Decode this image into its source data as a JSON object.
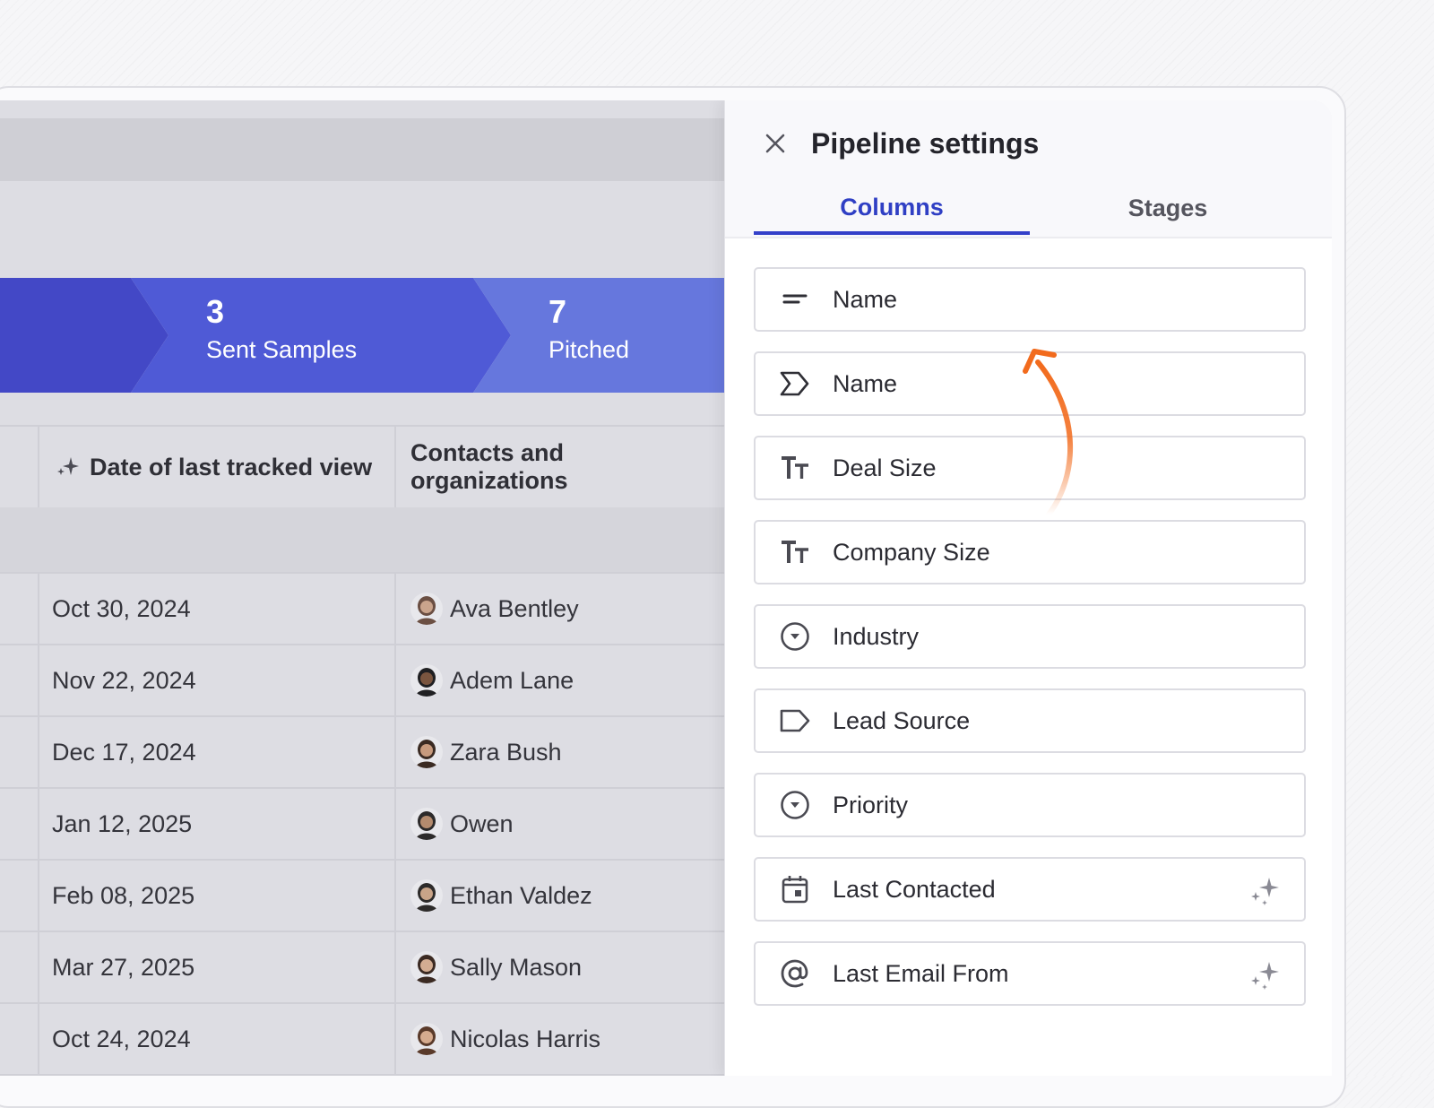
{
  "pipeline": {
    "stages": [
      {
        "count": "3",
        "label": "Sent Samples"
      },
      {
        "count": "7",
        "label": "Pitched"
      }
    ],
    "colors": {
      "stage1": "#4348c6",
      "stage2": "#4f5ad6",
      "stage3": "#6677dd"
    }
  },
  "table": {
    "headers": {
      "date": "Date of last tracked view",
      "contacts": "Contacts and organizations"
    },
    "rows": [
      {
        "date": "Oct 30, 2024",
        "contact": "Ava Bentley"
      },
      {
        "date": "Nov 22, 2024",
        "contact": "Adem Lane"
      },
      {
        "date": "Dec 17, 2024",
        "contact": "Zara Bush"
      },
      {
        "date": "Jan 12, 2025",
        "contact": "Owen"
      },
      {
        "date": "Feb 08, 2025",
        "contact": "Ethan Valdez"
      },
      {
        "date": "Mar 27, 2025",
        "contact": "Sally Mason"
      },
      {
        "date": "Oct 24, 2024",
        "contact": "Nicolas Harris"
      }
    ]
  },
  "panel": {
    "title": "Pipeline settings",
    "tabs": {
      "columns": "Columns",
      "stages": "Stages"
    },
    "fields": [
      {
        "label": "Name",
        "icon": "text-lines-icon"
      },
      {
        "label": "Name",
        "icon": "chevron-tag-icon"
      },
      {
        "label": "Deal Size",
        "icon": "text-size-icon"
      },
      {
        "label": "Company Size",
        "icon": "text-size-icon"
      },
      {
        "label": "Industry",
        "icon": "dropdown-circle-icon"
      },
      {
        "label": "Lead Source",
        "icon": "tag-icon"
      },
      {
        "label": "Priority",
        "icon": "dropdown-circle-icon"
      },
      {
        "label": "Last Contacted",
        "icon": "calendar-icon",
        "ai": true
      },
      {
        "label": "Last Email From",
        "icon": "at-icon",
        "ai": true
      }
    ],
    "accent": "#3340c9",
    "arrow_color": "#f26b1d"
  }
}
